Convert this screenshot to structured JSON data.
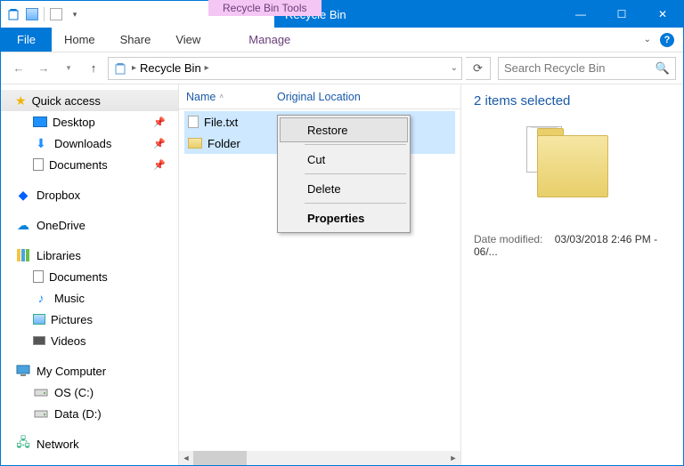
{
  "window": {
    "context_tab": "Recycle Bin Tools",
    "title": "Recycle Bin",
    "minimize": "—",
    "maximize": "☐",
    "close": "✕"
  },
  "ribbon": {
    "file": "File",
    "tabs": [
      "Home",
      "Share",
      "View"
    ],
    "manage": "Manage"
  },
  "address": {
    "location": "Recycle Bin",
    "sep": "▸",
    "search_placeholder": "Search Recycle Bin"
  },
  "nav": {
    "quick_access": "Quick access",
    "qa_items": [
      {
        "label": "Desktop",
        "pinned": true
      },
      {
        "label": "Downloads",
        "pinned": true
      },
      {
        "label": "Documents",
        "pinned": true
      }
    ],
    "dropbox": "Dropbox",
    "onedrive": "OneDrive",
    "libraries": "Libraries",
    "lib_items": [
      "Documents",
      "Music",
      "Pictures",
      "Videos"
    ],
    "mycomputer": "My Computer",
    "drives": [
      "OS (C:)",
      "Data (D:)"
    ],
    "network": "Network"
  },
  "columns": {
    "name": "Name",
    "orig": "Original Location"
  },
  "files": [
    {
      "name": "File.txt",
      "type": "file"
    },
    {
      "name": "Folder",
      "type": "folder"
    }
  ],
  "context_menu": {
    "restore": "Restore",
    "cut": "Cut",
    "delete": "Delete",
    "properties": "Properties"
  },
  "preview": {
    "heading": "2 items selected",
    "meta_label": "Date modified:",
    "meta_value": "03/03/2018 2:46 PM - 06/..."
  }
}
